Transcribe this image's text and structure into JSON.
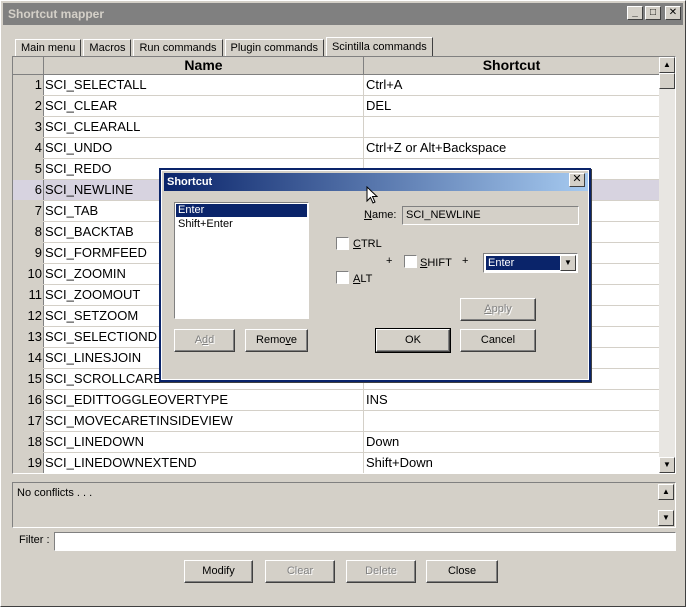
{
  "window": {
    "title": "Shortcut mapper",
    "min_glyph": "_",
    "max_glyph": "□",
    "close_glyph": "✕"
  },
  "tabs": [
    "Main menu",
    "Macros",
    "Run commands",
    "Plugin commands",
    "Scintilla commands"
  ],
  "active_tab": 4,
  "grid": {
    "headers": {
      "name": "Name",
      "shortcut": "Shortcut"
    },
    "rows": [
      {
        "num": "1",
        "name": "SCI_SELECTALL",
        "shortcut": "Ctrl+A"
      },
      {
        "num": "2",
        "name": "SCI_CLEAR",
        "shortcut": "DEL"
      },
      {
        "num": "3",
        "name": "SCI_CLEARALL",
        "shortcut": ""
      },
      {
        "num": "4",
        "name": "SCI_UNDO",
        "shortcut": "Ctrl+Z or Alt+Backspace"
      },
      {
        "num": "5",
        "name": "SCI_REDO",
        "shortcut": ""
      },
      {
        "num": "6",
        "name": "SCI_NEWLINE",
        "shortcut": ""
      },
      {
        "num": "7",
        "name": "SCI_TAB",
        "shortcut": ""
      },
      {
        "num": "8",
        "name": "SCI_BACKTAB",
        "shortcut": ""
      },
      {
        "num": "9",
        "name": "SCI_FORMFEED",
        "shortcut": ""
      },
      {
        "num": "10",
        "name": "SCI_ZOOMIN",
        "shortcut": ""
      },
      {
        "num": "11",
        "name": "SCI_ZOOMOUT",
        "shortcut": ""
      },
      {
        "num": "12",
        "name": "SCI_SETZOOM",
        "shortcut": ""
      },
      {
        "num": "13",
        "name": "SCI_SELECTIOND",
        "shortcut": ""
      },
      {
        "num": "14",
        "name": "SCI_LINESJOIN",
        "shortcut": ""
      },
      {
        "num": "15",
        "name": "SCI_SCROLLCARET",
        "shortcut": ""
      },
      {
        "num": "16",
        "name": "SCI_EDITTOGGLEOVERTYPE",
        "shortcut": "INS"
      },
      {
        "num": "17",
        "name": "SCI_MOVECARETINSIDEVIEW",
        "shortcut": ""
      },
      {
        "num": "18",
        "name": "SCI_LINEDOWN",
        "shortcut": "Down"
      },
      {
        "num": "19",
        "name": "SCI_LINEDOWNEXTEND",
        "shortcut": "Shift+Down"
      }
    ],
    "selected_row": 5
  },
  "conflicts": {
    "text": "No conflicts . . ."
  },
  "filter": {
    "label": "Filter :",
    "value": ""
  },
  "buttons": {
    "modify": "Modify",
    "clear": "Clear",
    "delete": "Delete",
    "close": "Close"
  },
  "dialog": {
    "title": "Shortcut",
    "close_glyph": "✕",
    "list": [
      "Enter",
      "Shift+Enter"
    ],
    "list_selected": 0,
    "name_label": "Name:",
    "name_value": "SCI_NEWLINE",
    "ctrl_label": "CTRL",
    "alt_label": "ALT",
    "shift_label": "SHIFT",
    "plus": "+",
    "key_value": "Enter",
    "apply": "Apply",
    "add": "Add",
    "remove": "Remove",
    "ok": "OK",
    "cancel": "Cancel"
  }
}
